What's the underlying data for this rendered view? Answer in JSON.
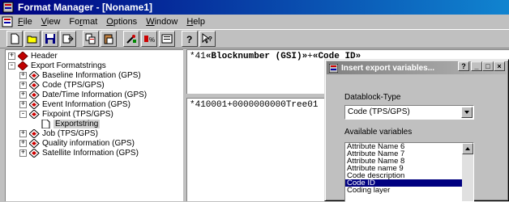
{
  "window": {
    "title": "Format Manager - [Noname1]"
  },
  "menu": {
    "items": [
      {
        "u": "F",
        "rest": "ile"
      },
      {
        "u": "V",
        "rest": "iew"
      },
      {
        "pre": "Fo",
        "u": "r",
        "rest": "mat"
      },
      {
        "u": "O",
        "rest": "ptions"
      },
      {
        "u": "W",
        "rest": "indow"
      },
      {
        "u": "H",
        "rest": "elp"
      }
    ]
  },
  "toolbar": {
    "buttons": [
      "new",
      "open",
      "save",
      "export",
      "cut-copy",
      "paste",
      "tool-a",
      "tool-b",
      "properties",
      "help",
      "context-help"
    ]
  },
  "tree": {
    "items": [
      {
        "label": "Header",
        "expander": "+",
        "icon": "diamond-red-icon",
        "level": 0
      },
      {
        "label": "Export Formatstrings",
        "expander": "-",
        "icon": "diamond-red-icon",
        "level": 0
      },
      {
        "label": "Baseline Information (GPS)",
        "expander": "+",
        "icon": "diamond-icon",
        "level": 1
      },
      {
        "label": "Code (TPS/GPS)",
        "expander": "+",
        "icon": "diamond-icon",
        "level": 1
      },
      {
        "label": "Date/Time Information (GPS)",
        "expander": "+",
        "icon": "diamond-icon",
        "level": 1
      },
      {
        "label": "Event Information (GPS)",
        "expander": "+",
        "icon": "diamond-icon",
        "level": 1
      },
      {
        "label": "Fixpoint (TPS/GPS)",
        "expander": "-",
        "icon": "diamond-icon",
        "level": 1
      },
      {
        "label": "Exportstring",
        "expander": "",
        "icon": "page-icon",
        "level": 2,
        "selected": true
      },
      {
        "label": "Job (TPS/GPS)",
        "expander": "+",
        "icon": "diamond-icon",
        "level": 1
      },
      {
        "label": "Quality information (GPS)",
        "expander": "+",
        "icon": "diamond-icon",
        "level": 1
      },
      {
        "label": "Satellite Information (GPS)",
        "expander": "+",
        "icon": "diamond-icon",
        "level": 1
      }
    ]
  },
  "editor": {
    "format_line_prefix": "*41",
    "format_line_var1": "«Blocknumber (GSI)»",
    "format_line_mid": "+",
    "format_line_var2": "«Code ID»",
    "preview_line": "*410001+0000000000Tree01"
  },
  "dialog": {
    "title": "Insert export variables...",
    "caption_buttons": [
      "?",
      "_",
      "□",
      "×"
    ],
    "datablock_label": "Datablock-Type",
    "datablock_value": "Code (TPS/GPS)",
    "variables_label": "Available variables",
    "variables": [
      "Attribute Name 6",
      "Attribute Name 7",
      "Attribute Name 8",
      "Attribute name 9",
      "Code description",
      "Code ID",
      "Coding layer"
    ],
    "selected_variable": "Code ID"
  }
}
